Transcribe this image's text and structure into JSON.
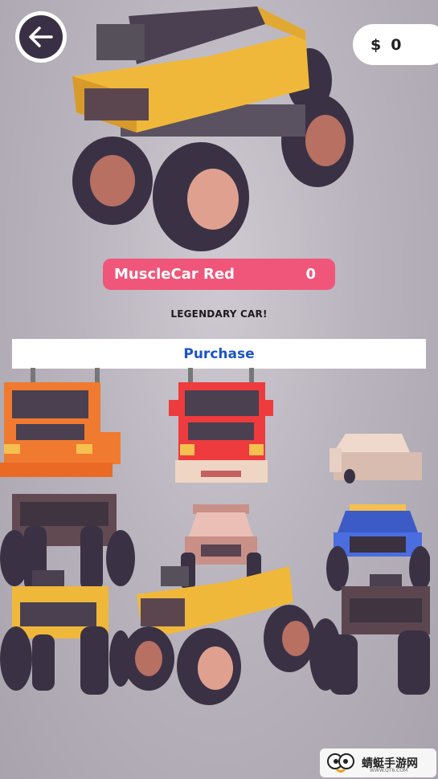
{
  "header": {
    "back_icon": "arrow-left-icon",
    "currency_symbol": "$",
    "money": "0"
  },
  "selected_car": {
    "name": "MuscleCar Red",
    "count": "0",
    "rarity": "LEGENDARY CAR!"
  },
  "purchase_label": "Purchase",
  "watermark": {
    "brand": "蜻蜓手游网",
    "url": "WWW.QT6.COM"
  },
  "colors": {
    "name_bar": "#f0567a",
    "purchase_text": "#1a54c8",
    "background": "#b9b4bd"
  },
  "garage_vehicles": [
    {
      "name": "orange-truck"
    },
    {
      "name": "red-truck"
    },
    {
      "name": "beige-sedan"
    },
    {
      "name": "brown-monster-truck"
    },
    {
      "name": "pink-monster-truck"
    },
    {
      "name": "blue-monster-truck"
    },
    {
      "name": "yellow-monster-truck-small"
    },
    {
      "name": "yellow-monster-truck-large"
    },
    {
      "name": "dark-monster-truck"
    }
  ]
}
